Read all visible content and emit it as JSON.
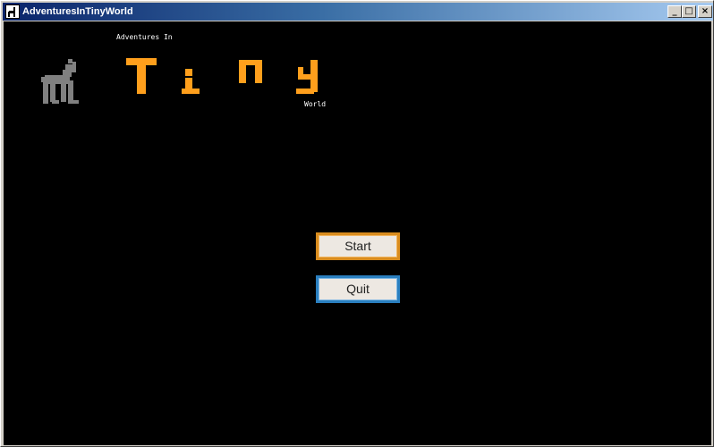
{
  "window": {
    "title": "AdventuresInTinyWorld",
    "controls": {
      "minimize": "_",
      "maximize": "□",
      "close": "×"
    }
  },
  "logo": {
    "top_text": "Adventures In",
    "main_text": "Tiny",
    "bottom_text": "World",
    "color": "#ff9f1c"
  },
  "mascot": {
    "name": "dog-icon",
    "color": "#808080"
  },
  "menu": {
    "start_label": "Start",
    "quit_label": "Quit",
    "start_border_color": "#d98c1e",
    "quit_border_color": "#2a7fbf"
  }
}
